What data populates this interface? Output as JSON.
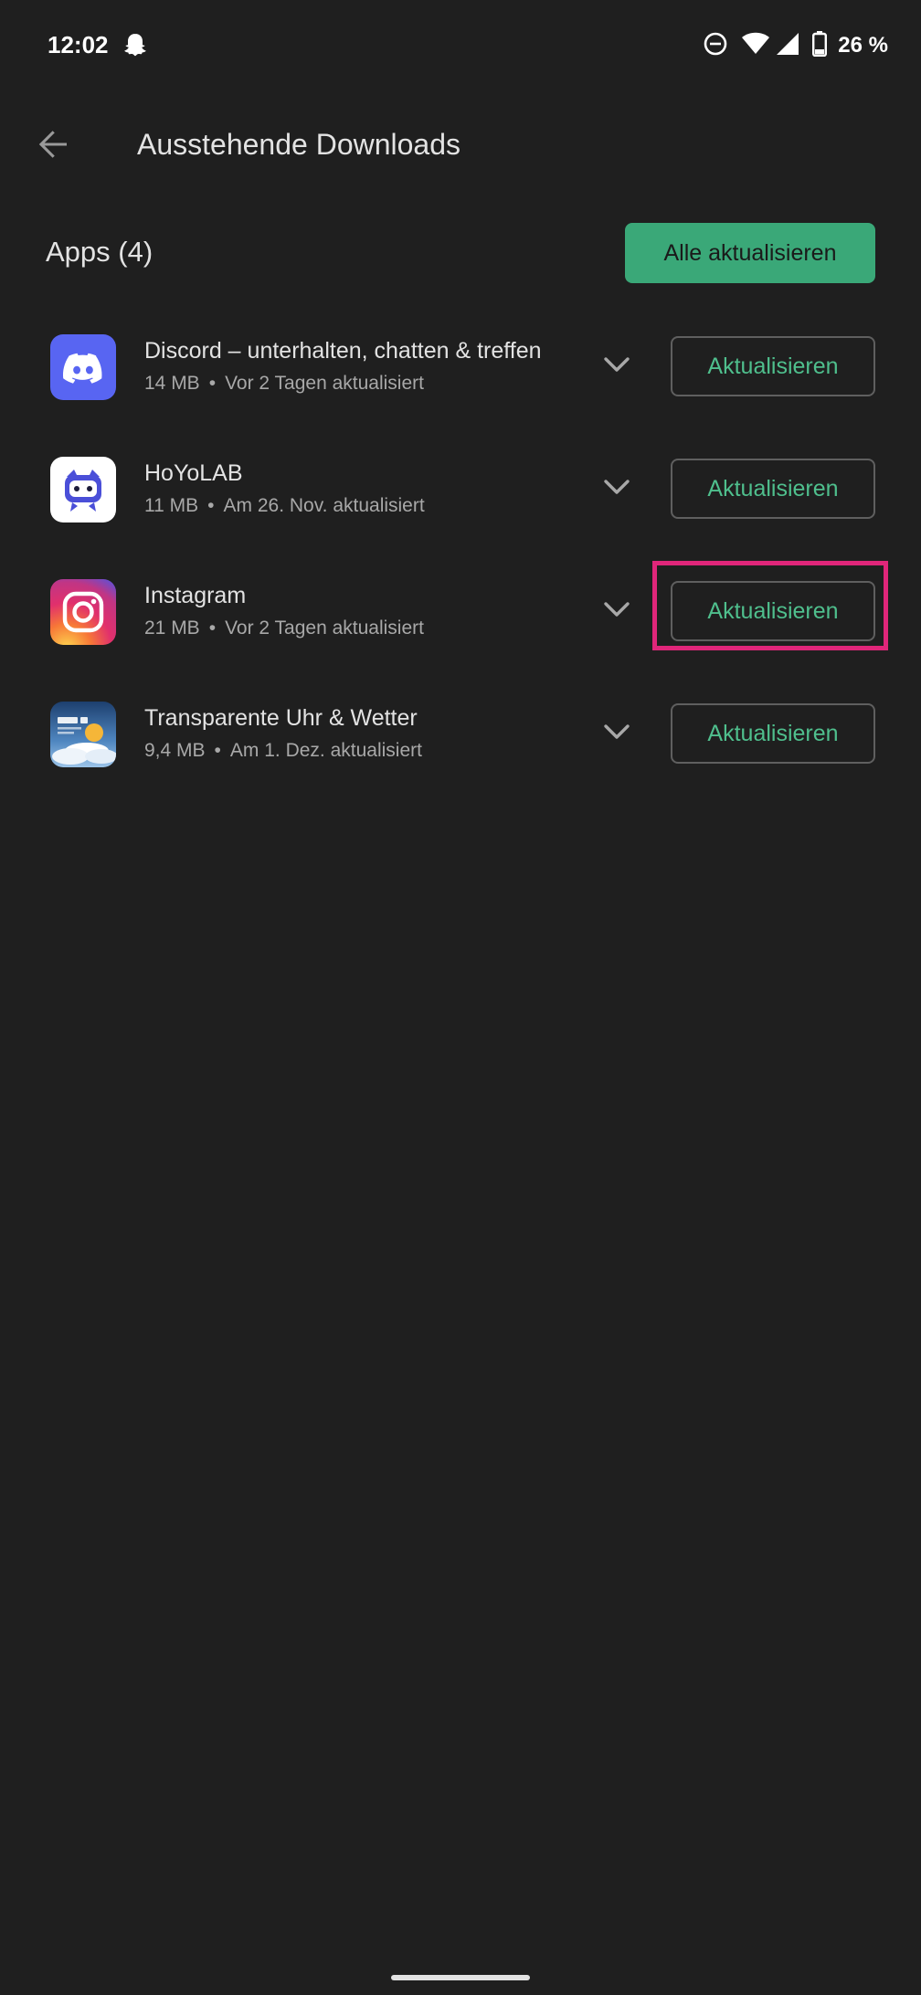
{
  "status_bar": {
    "time": "12:02",
    "battery": "26 %",
    "icons": [
      "snapchat-ghost-icon",
      "do-not-disturb-icon",
      "wifi-icon",
      "signal-icon",
      "battery-icon"
    ]
  },
  "header": {
    "title": "Ausstehende Downloads",
    "back_icon": "arrow-back-icon"
  },
  "section": {
    "title": "Apps (4)",
    "update_all_label": "Alle aktualisieren"
  },
  "apps": [
    {
      "name": "Discord – unterhalten, chatten & treffen",
      "size": "14 MB",
      "separator": "•",
      "updated": "Vor 2 Tagen aktualisiert",
      "update_label": "Aktualisieren",
      "icon": "discord-icon"
    },
    {
      "name": "HoYoLAB",
      "size": "11 MB",
      "separator": "•",
      "updated": "Am 26. Nov. aktualisiert",
      "update_label": "Aktualisieren",
      "icon": "hoyolab-icon"
    },
    {
      "name": "Instagram",
      "size": "21 MB",
      "separator": "•",
      "updated": "Vor 2 Tagen aktualisiert",
      "update_label": "Aktualisieren",
      "icon": "instagram-icon"
    },
    {
      "name": "Transparente Uhr & Wetter",
      "size": "9,4 MB",
      "separator": "•",
      "updated": "Am 1. Dez. aktualisiert",
      "update_label": "Aktualisieren",
      "icon": "weather-clock-icon"
    }
  ],
  "colors": {
    "background": "#1f1f1f",
    "accent": "#3aa878",
    "accent_text": "#4fbf8d",
    "highlight": "#e0267a"
  }
}
